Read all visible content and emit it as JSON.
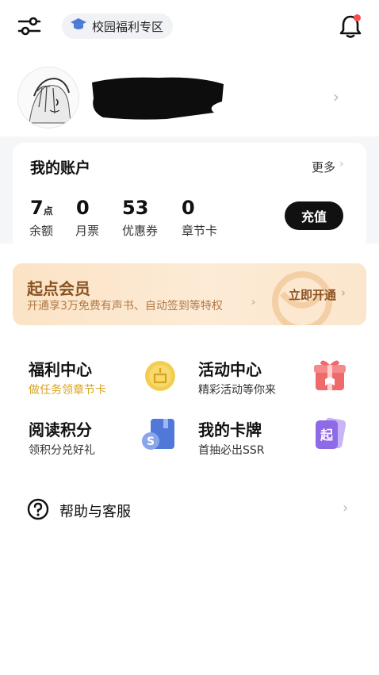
{
  "header": {
    "filter_icon": "sliders-icon",
    "campus_pill": {
      "icon": "graduation-cap-icon",
      "label": "校园福利专区"
    },
    "bell_icon": "bell-icon",
    "has_notification": true
  },
  "profile": {
    "avatar_icon": "avatar-image",
    "chevron": "›"
  },
  "account": {
    "title": "我的账户",
    "more_label": "更多",
    "more_chevron": "›",
    "stats": [
      {
        "value": "7",
        "unit": "点",
        "label": "余额"
      },
      {
        "value": "0",
        "unit": "",
        "label": "月票"
      },
      {
        "value": "53",
        "unit": "",
        "label": "优惠券"
      },
      {
        "value": "0",
        "unit": "",
        "label": "章节卡"
      }
    ],
    "recharge_label": "充值"
  },
  "member": {
    "title": "起点会员",
    "subtitle": "开通享3万免费有声书、自动签到等特权",
    "sub_chevron": "›",
    "open_label": "立即开通",
    "open_chevron": "›"
  },
  "features": [
    {
      "title": "福利中心",
      "subtitle": "做任务领章节卡",
      "icon": "gold-coin-icon"
    },
    {
      "title": "活动中心",
      "subtitle": "精彩活动等你来",
      "icon": "gift-box-icon"
    },
    {
      "title": "阅读积分",
      "subtitle": "领积分兑好礼",
      "icon": "points-book-icon"
    },
    {
      "title": "我的卡牌",
      "subtitle": "首抽必出SSR",
      "icon": "card-deck-icon"
    }
  ],
  "help": {
    "label": "帮助与客服",
    "icon": "question-circle-icon",
    "chevron": "›"
  },
  "colors": {
    "accent_dark": "#111111",
    "member_brown": "#8a5222",
    "gold": "#d9a21f",
    "notify_red": "#ff4d4f"
  }
}
